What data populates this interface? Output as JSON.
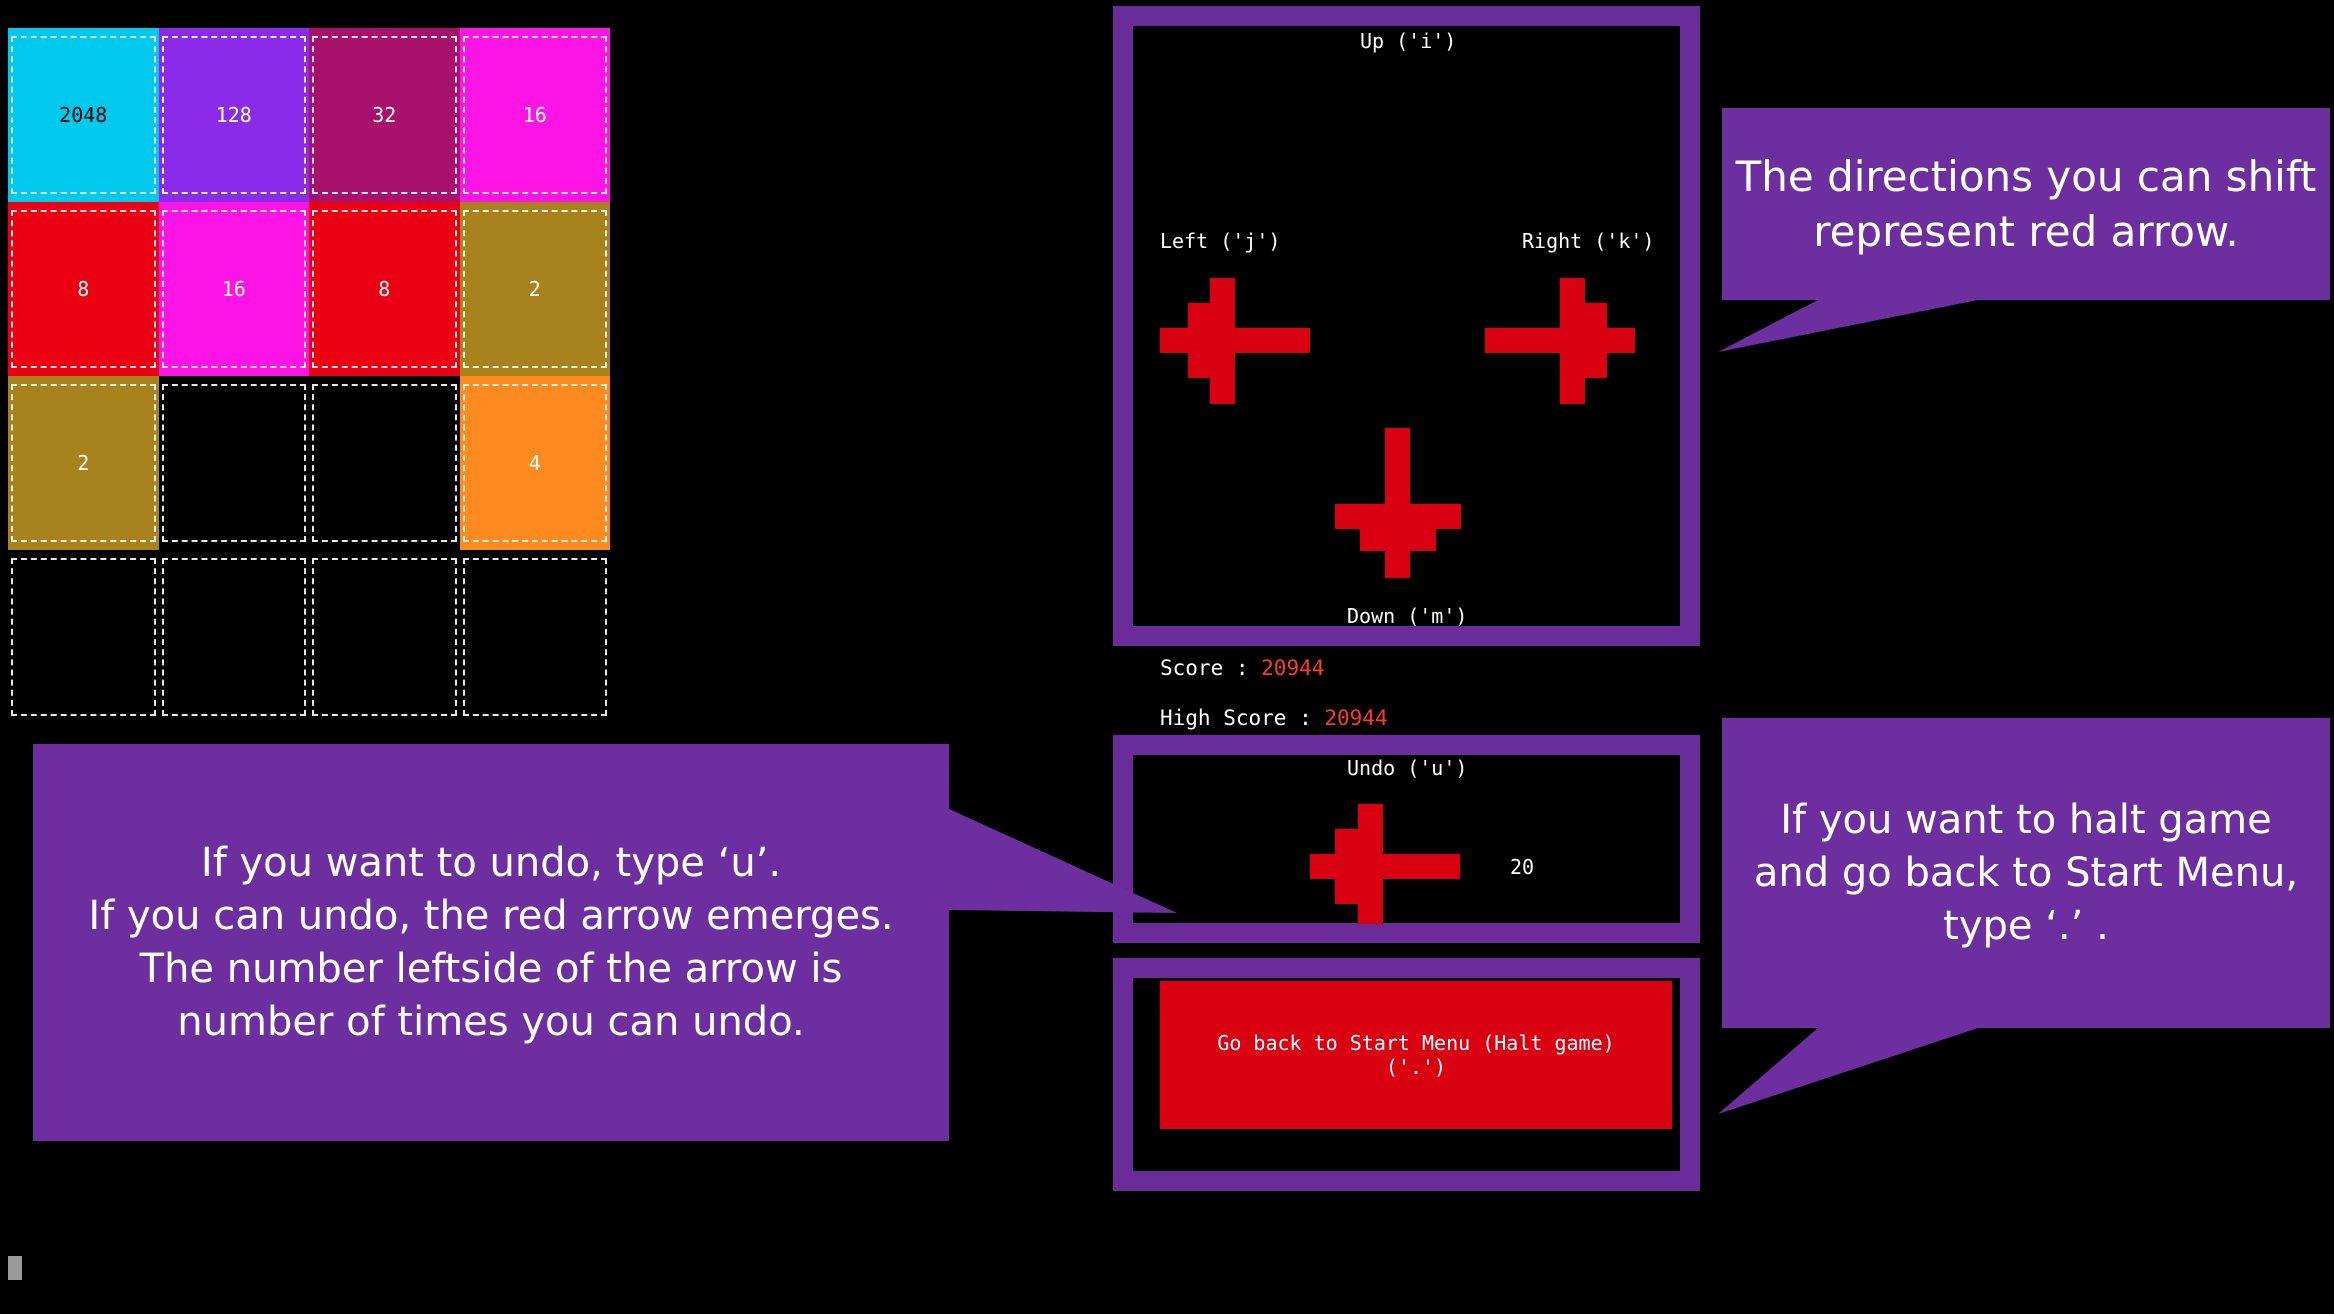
{
  "board": {
    "tiles": [
      {
        "value": "2048",
        "color": "#00c9ee"
      },
      {
        "value": "128",
        "color": "#8a2be9"
      },
      {
        "value": "32",
        "color": "#a8106b"
      },
      {
        "value": "16",
        "color": "#ff14e6"
      },
      {
        "value": "8",
        "color": "#ea0012"
      },
      {
        "value": "16",
        "color": "#ff14e6"
      },
      {
        "value": "8",
        "color": "#ea0012"
      },
      {
        "value": "2",
        "color": "#a8821d"
      },
      {
        "value": "2",
        "color": "#a8821d"
      },
      {
        "value": "",
        "color": "#000000"
      },
      {
        "value": "",
        "color": "#000000"
      },
      {
        "value": "4",
        "color": "#ff8a1f"
      },
      {
        "value": "",
        "color": "#000000"
      },
      {
        "value": "",
        "color": "#000000"
      },
      {
        "value": "",
        "color": "#000000"
      },
      {
        "value": "",
        "color": "#000000"
      }
    ]
  },
  "controls": {
    "up_label": "Up ('i')",
    "left_label": "Left ('j')",
    "right_label": "Right ('k')",
    "down_label": "Down ('m')",
    "arrow_color": "#d90011",
    "frame_color": "#6a2c9b"
  },
  "score": {
    "label": "Score : ",
    "value": "20944",
    "high_label": "High Score : ",
    "high_value": "20944"
  },
  "undo": {
    "label": "Undo ('u')",
    "count": "20"
  },
  "halt": {
    "line1": "Go back to Start Menu (Halt game)",
    "line2": "('.')"
  },
  "callouts": {
    "directions": [
      "The directions you can shift",
      "represent red arrow."
    ],
    "undo": [
      "If you want to undo, type ‘u’.",
      "If you can undo, the red arrow emerges.",
      "The number leftside of the arrow is",
      "number of times you can undo."
    ],
    "halt": [
      "If you want to halt game",
      "and go back to Start Menu,",
      "type ‘.’ ."
    ]
  }
}
